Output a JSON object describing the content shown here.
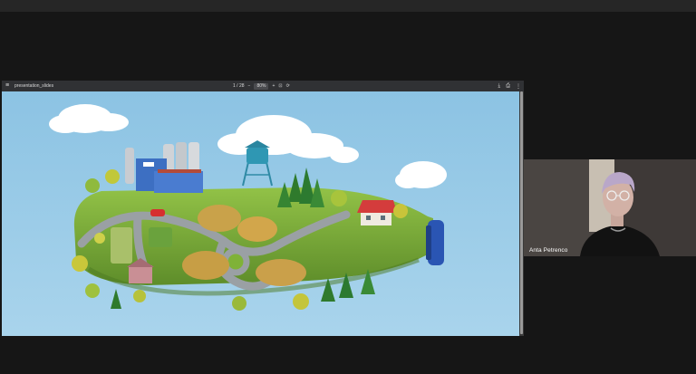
{
  "viewer": {
    "filename": "presentation_slides",
    "page_label": "1 / 28",
    "zoom": "80%",
    "menu_icon": "hamburger-icon",
    "colors": {
      "toolbar": "#303134",
      "sky": "#8dc3e2",
      "grass": "#7fb238"
    }
  },
  "participant": {
    "name": "Anta Petrenco"
  }
}
